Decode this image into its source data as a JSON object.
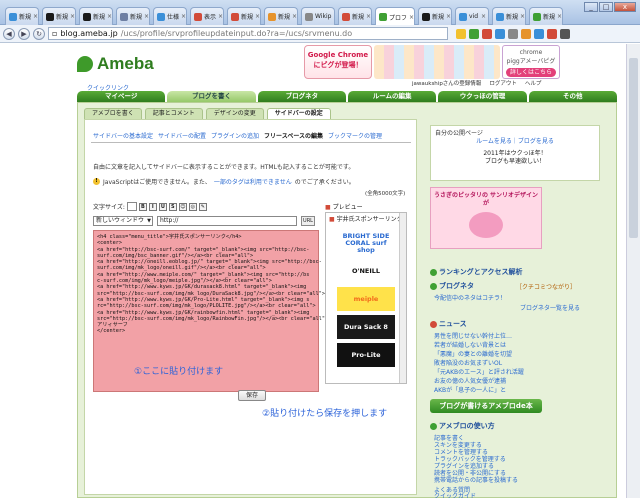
{
  "browser": {
    "tabs": [
      {
        "label": "新規",
        "color": "#3a8fd8"
      },
      {
        "label": "新規",
        "color": "#1a1a1a"
      },
      {
        "label": "新規",
        "color": "#1a1a1a"
      },
      {
        "label": "新規",
        "color": "#6e7fa3"
      },
      {
        "label": "仕様",
        "color": "#3a8fd8"
      },
      {
        "label": "表示",
        "color": "#d24b39"
      },
      {
        "label": "新規",
        "color": "#d24b39"
      },
      {
        "label": "新規",
        "color": "#e6932c"
      },
      {
        "label": "Wikip",
        "color": "#888888"
      },
      {
        "label": "新規",
        "color": "#d24b39"
      },
      {
        "label": "プロフ",
        "color": "#3fa034"
      },
      {
        "label": "新規",
        "color": "#1a1a1a"
      },
      {
        "label": "vid",
        "color": "#3a8fd8"
      },
      {
        "label": "新規",
        "color": "#3a8fd8"
      },
      {
        "label": "新規",
        "color": "#3fa034"
      }
    ],
    "url_host": "blog.ameba.jp",
    "url_path": "/ucs/profile/srvprofileupdateinput.do?ra=/ucs/srvmenu.do",
    "window_min": "_",
    "window_max": "□",
    "window_close": "x"
  },
  "site": {
    "logo": "Ameba",
    "quick_link": "クイックリンク",
    "banner": {
      "google": "Google Chromeにピグが登場！",
      "chrome": "chrome",
      "pigg": "piggアメーバピグ",
      "install": "詳しくはこちら"
    },
    "userbar": [
      "jawaukshipさんの登録情報",
      "ログアウト",
      "ヘルプ"
    ],
    "global_nav": [
      "マイページ",
      "ブログを書く",
      "ブログネタ",
      "ルームの編集",
      "ウクっほの管理",
      "その他"
    ]
  },
  "sub_nav": [
    "アメブロを書く",
    "記事とコメント",
    "デザインの変更",
    "サイドバーの設定"
  ],
  "breadcrumb": [
    {
      "label": "サイドバーの基本設定",
      "current": false
    },
    {
      "label": "サイドバーの配置",
      "current": false
    },
    {
      "label": "プラグインの追加",
      "current": false
    },
    {
      "label": "フリースペースの編集",
      "current": true
    },
    {
      "label": "ブックマークの管理",
      "current": false
    }
  ],
  "form": {
    "description": "自由に文章を記入してサイドバーに表示することができます。HTMLも記入することが可能です。",
    "warning_text": "JavaScriptはご使用できません。また、",
    "warning_link": "一部のタグは利用できません",
    "warning_tail": "のでご了承ください。",
    "limit": "(全角5000文字)",
    "font_size_label": "文字サイズ:",
    "toolbar": [
      "B",
      "I",
      "U",
      "S",
      "☺",
      "◎",
      "✎"
    ],
    "link_target": "新しいウィンドウ",
    "url_value": "http://",
    "url_button": "URL",
    "editor_text": "<h4 class=\"menu_title\">宇井氏スポンサーリンク</h4>\n<center>\n<a href=\"http://bsc-surf.com/\" target=\"_blank\"><img src=\"http://bsc-\nsurf.com/img/bsc_banner.gif\"/></a><br clear=\"all\">\n<a href=\"http://oneill.eoblog.jp/\" target=\"_blank\"><img src=\"http://bsc-\nsurf.com/img/mk_logo/oneill.gif\"/></a><br clear=\"all\">\n<a href=\"http://www.meiple.com/\" target=\"_blank\"><img src=\"http://bs\nc-surf.com/img/mk_logo/meiple.jpg\"/></a><br clear=\"all\">\n<a href=\"http://www.kyws.jp/GK/durasack8.html\" target=\"_blank\"><img\nsrc=\"http://bsc-surf.com/img/mk_logo/DuraSack8.jpg\"/></a><br clear=\"all\">\n<a href=\"http://www.kyws.jp/GK/Pro-Lite.html\" target=\"_blank\"><img s\nrc=\"http://bsc-surf.com/img/mk_logo/PLOLITE.jpg\"/></a><br clear=\"all\">\n<a href=\"http://www.kyws.jp/GK/rainbowfin.html\" target=\"_blank\"><img\nsrc=\"http://bsc-surf.com/img/mk_logo/RainbowFin.jpg\"/></a><br clear=\"all\">\nアリィサーフ\n</center>",
    "annotation_paste": "①ここに貼り付けます",
    "save_label": "保存",
    "annotation_save": "②貼り付けたら保存を押します"
  },
  "preview": {
    "label": "プレビュー",
    "title": "宇井氏スポンサーリンク",
    "logos": [
      {
        "text": "BRIGHT SIDE CORAL surf shop",
        "color": "#2a6ad0",
        "bg": "#ffffff"
      },
      {
        "text": "O'NEILL",
        "color": "#111111",
        "bg": "#ffffff"
      },
      {
        "text": "meiple",
        "color": "#f26a1b",
        "bg": "#ffe24a"
      },
      {
        "text": "Dura Sack 8",
        "color": "#ffffff",
        "bg": "#1a1a1a"
      },
      {
        "text": "Pro-Lite",
        "color": "#ffffff",
        "bg": "#111111"
      }
    ]
  },
  "sidebar": {
    "profile_label": "自分の公開ページ",
    "profile_link": "ルームを見る｜ブログを見る",
    "news1": "2011年はウクっほ年！",
    "news2": "ブログも早速欲しい！",
    "promo": "うさぎのピッタリの サンリオデザインが",
    "ranking": "ランキングとアクセス解析",
    "blog_neta": "ブログネタ",
    "neta_link": "［クチコミつながり］",
    "neta_item": "今配信中のネタはコチラ！",
    "neta_more": "ブログネタ一覧を見る",
    "news_head": "ニュース",
    "news_items": [
      "男性を閉じせない幹付上位…",
      "若者が結婚しない背景とは",
      "「悪魔」の妻との離婚を切望",
      "敗者陥没のお気まずいOL",
      "「元AKBのエース」と評され活躍",
      "お友の億の人気女優が逮捕",
      "AKBが「息子の一人に」と"
    ],
    "app_banner": "ブログが書けるアメブロde本",
    "howto_head": "アメブロの使い方",
    "howto": [
      "記事を書く",
      "スキンを変更する",
      "コメントを管理する",
      "トラックバックを管理する",
      "プラグインを追加する",
      "読者を公開・非公開にする",
      "携帯電話からの記事を投稿する"
    ],
    "faq": [
      "よくある質問",
      "クイックガイド",
      "利用規約"
    ]
  }
}
